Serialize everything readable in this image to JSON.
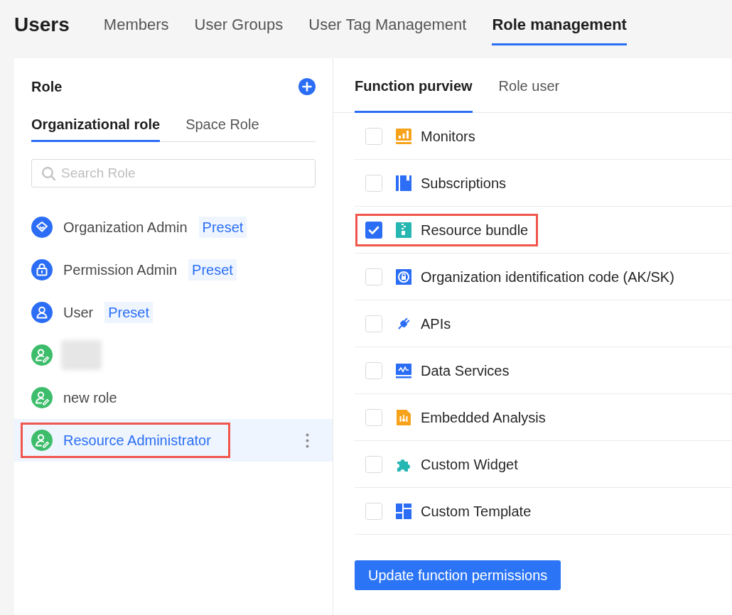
{
  "header": {
    "title": "Users",
    "tabs": [
      {
        "label": "Members",
        "selected": false
      },
      {
        "label": "User Groups",
        "selected": false
      },
      {
        "label": "User Tag Management",
        "selected": false
      },
      {
        "label": "Role management",
        "selected": true
      }
    ]
  },
  "roles_panel": {
    "title": "Role",
    "tabs": [
      {
        "label": "Organizational role",
        "selected": true
      },
      {
        "label": "Space Role",
        "selected": false
      }
    ],
    "search": {
      "placeholder": "Search Role"
    },
    "roles": [
      {
        "name": "Organization Admin",
        "badge": "Preset",
        "redacted": false,
        "selected": false,
        "highlighted": false
      },
      {
        "name": "Permission Admin",
        "badge": "Preset",
        "redacted": false,
        "selected": false,
        "highlighted": false
      },
      {
        "name": "User",
        "badge": "Preset",
        "redacted": false,
        "selected": false,
        "highlighted": false
      },
      {
        "redacted": true,
        "selected": false,
        "highlighted": false
      },
      {
        "name": "new role",
        "redacted": false,
        "selected": false,
        "highlighted": false
      },
      {
        "name": "Resource Administrator",
        "redacted": false,
        "selected": true,
        "highlighted": true
      }
    ]
  },
  "function_panel": {
    "tabs": [
      {
        "label": "Function purview",
        "selected": true
      },
      {
        "label": "Role user",
        "selected": false
      }
    ],
    "functions": [
      {
        "label": "Monitors",
        "checked": false,
        "highlighted": false
      },
      {
        "label": "Subscriptions",
        "checked": false,
        "highlighted": false
      },
      {
        "label": "Resource bundle",
        "checked": true,
        "highlighted": true
      },
      {
        "label": "Organization identification code (AK/SK)",
        "checked": false,
        "highlighted": false
      },
      {
        "label": "APIs",
        "checked": false,
        "highlighted": false
      },
      {
        "label": "Data Services",
        "checked": false,
        "highlighted": false
      },
      {
        "label": "Embedded Analysis",
        "checked": false,
        "highlighted": false
      },
      {
        "label": "Custom Widget",
        "checked": false,
        "highlighted": false
      },
      {
        "label": "Custom Template",
        "checked": false,
        "highlighted": false
      }
    ],
    "button": "Update function permissions"
  }
}
